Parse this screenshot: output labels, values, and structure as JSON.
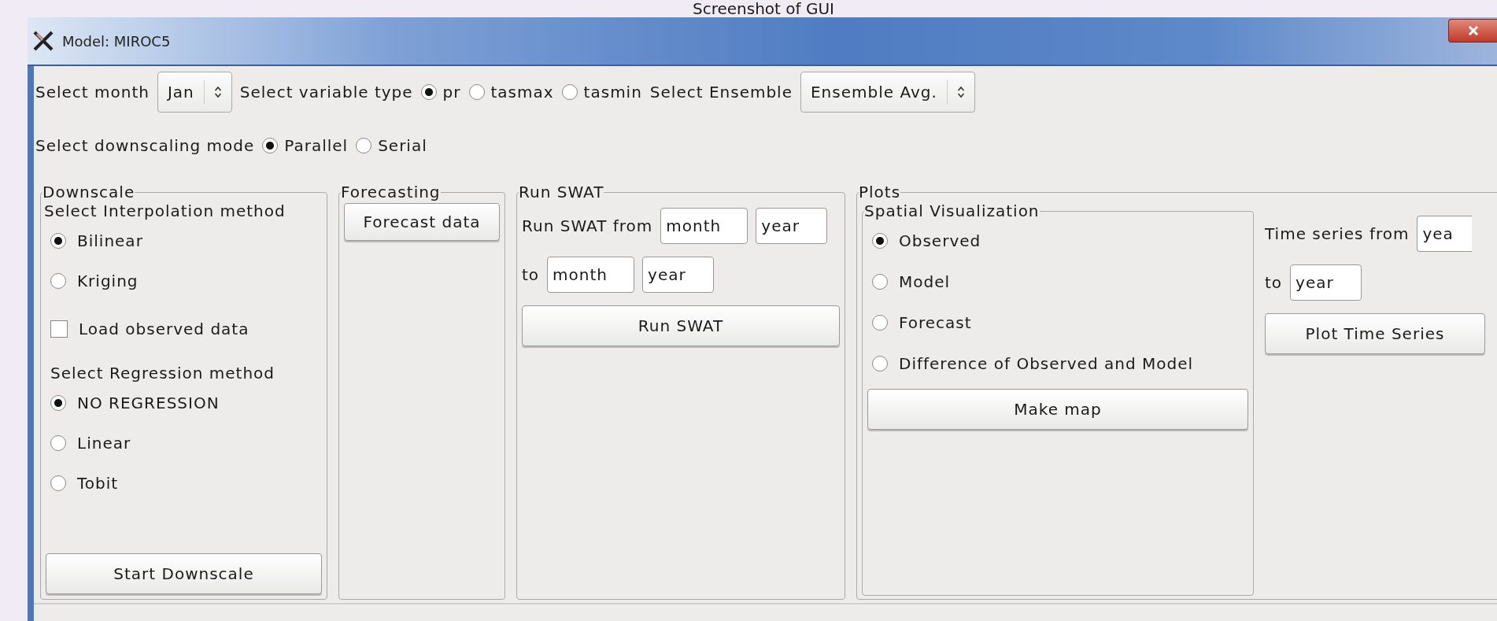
{
  "slide_title": "Screenshot of GUI",
  "window": {
    "title": "Model: MIROC5"
  },
  "top_row": {
    "month_label": "Select month",
    "month_value": "Jan",
    "variable_label": "Select variable type",
    "variable_options": [
      {
        "label": "pr",
        "selected": true
      },
      {
        "label": "tasmax",
        "selected": false
      },
      {
        "label": "tasmin",
        "selected": false
      }
    ],
    "ensemble_label": "Select Ensemble",
    "ensemble_value": "Ensemble Avg."
  },
  "mode_row": {
    "label": "Select downscaling mode",
    "options": [
      {
        "label": "Parallel",
        "selected": true
      },
      {
        "label": "Serial",
        "selected": false
      }
    ]
  },
  "downscale": {
    "title": "Downscale",
    "interp_label": "Select Interpolation method",
    "interp_options": [
      {
        "label": "Bilinear",
        "selected": true
      },
      {
        "label": "Kriging",
        "selected": false
      }
    ],
    "load_observed": {
      "label": "Load observed data",
      "checked": false
    },
    "regression_label": "Select Regression method",
    "regression_options": [
      {
        "label": "NO REGRESSION",
        "selected": true
      },
      {
        "label": "Linear",
        "selected": false
      },
      {
        "label": "Tobit",
        "selected": false
      }
    ],
    "button": "Start Downscale"
  },
  "forecasting": {
    "title": "Forecasting",
    "button": "Forecast data"
  },
  "run_swat": {
    "title": "Run SWAT",
    "from_label": "Run SWAT from",
    "from_month": "month",
    "from_year": "year",
    "to_label": "to",
    "to_month": "month",
    "to_year": "year",
    "button": "Run SWAT"
  },
  "plots": {
    "title": "Plots",
    "spatial": {
      "title": "Spatial Visualization",
      "options": [
        {
          "label": "Observed",
          "selected": true
        },
        {
          "label": "Model",
          "selected": false
        },
        {
          "label": "Forecast",
          "selected": false
        },
        {
          "label": "Difference of Observed and Model",
          "selected": false
        }
      ],
      "button": "Make map"
    },
    "time_series": {
      "from_label": "Time series from",
      "from_year": "yea",
      "to_label": "to",
      "to_year": "year",
      "button": "Plot Time Series"
    }
  }
}
